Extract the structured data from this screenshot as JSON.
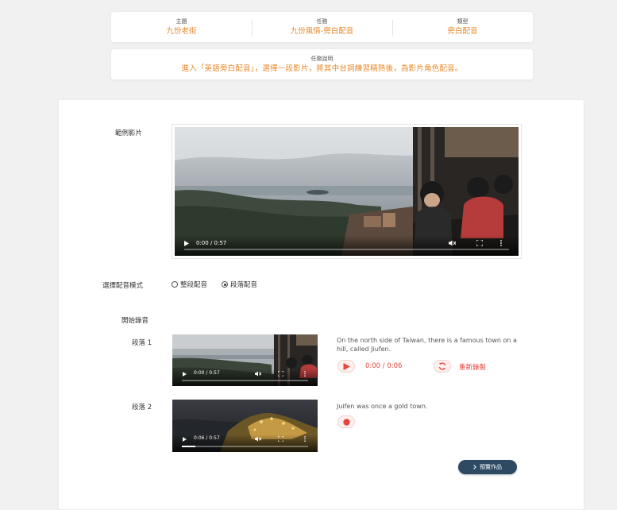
{
  "info": {
    "theme_label": "主題",
    "theme_value": "九份老街",
    "task_label": "任務",
    "task_value": "九份風情-旁白配音",
    "type_label": "類型",
    "type_value": "旁白配音"
  },
  "description": {
    "label": "任務說明",
    "text": "進入「英語旁白配音」，選擇一段影片，將其中台詞練習精熟後，為影片角色配音。"
  },
  "example_video": {
    "label": "範例影片",
    "time": "0:00 / 0:57",
    "progress": 0.0
  },
  "mode": {
    "label": "選擇配音模式",
    "options": [
      {
        "label": "整段配音",
        "selected": false
      },
      {
        "label": "段落配音",
        "selected": true
      }
    ]
  },
  "recording": {
    "label": "開始錄音",
    "segments": [
      {
        "label": "段落 1",
        "video_time": "0:00 / 0:57",
        "video_progress": 0.0,
        "text": "On the north side of Taiwan, there is a famous town on a hill, called Jiufen.",
        "playback_time": "0:00 / 0:06",
        "rerecord_label": "重新錄製"
      },
      {
        "label": "段落 2",
        "video_time": "0:06 / 0:57",
        "video_progress": 0.105,
        "text": "Juifen was once a gold town."
      }
    ]
  },
  "preview_button": {
    "label": "預覽作品"
  },
  "colors": {
    "accent_orange": "#e8892b",
    "record_red": "#e5463b",
    "button_navy": "#2d4a62"
  },
  "icons": [
    "play-icon",
    "mute-icon",
    "fullscreen-icon",
    "more-icon",
    "record-icon",
    "refresh-icon",
    "chevron-right-icon"
  ]
}
